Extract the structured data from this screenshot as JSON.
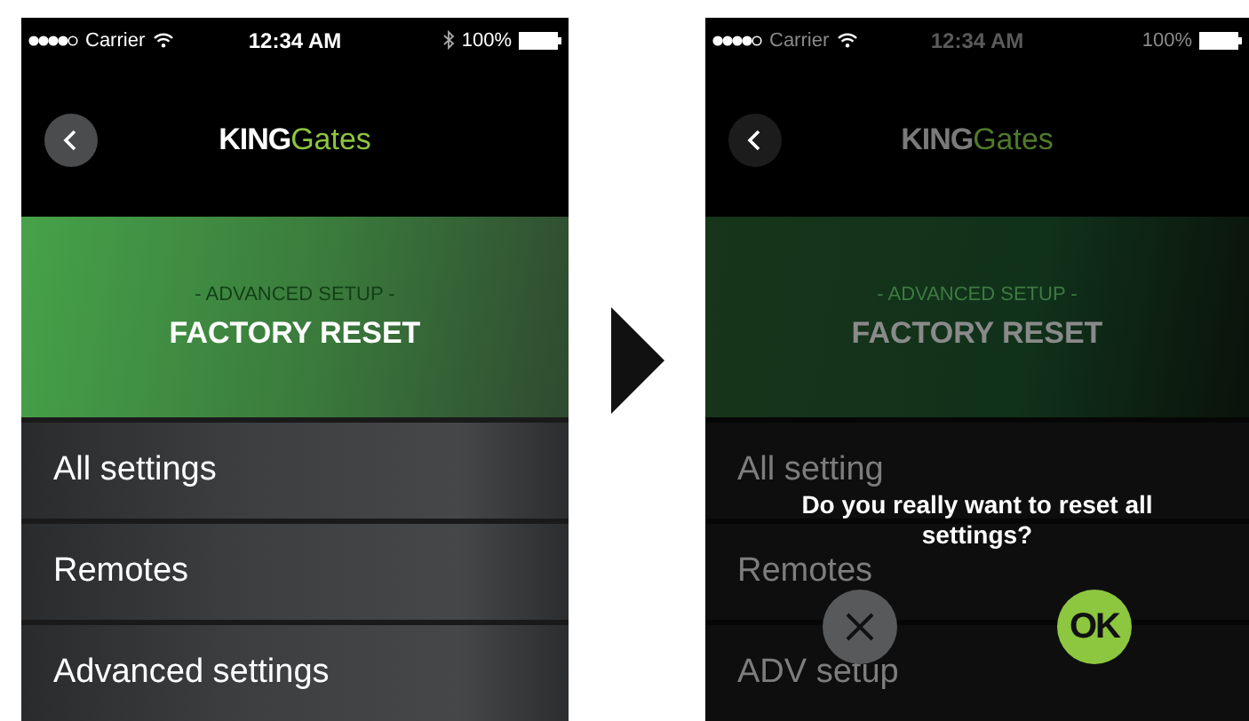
{
  "screens": [
    {
      "dimmed": false,
      "status_bar": {
        "carrier": "Carrier",
        "time": "12:34 AM",
        "battery": "100%",
        "bluetooth": true
      },
      "logo": {
        "bold": "KING",
        "light": "Gates"
      },
      "banner": {
        "subtitle": "- ADVANCED SETUP -",
        "title": "FACTORY RESET"
      },
      "menu": [
        "All settings",
        "Remotes",
        "Advanced settings"
      ]
    },
    {
      "dimmed": true,
      "status_bar": {
        "carrier": "Carrier",
        "time": "12:34 AM",
        "battery": "100%",
        "bluetooth": false
      },
      "logo": {
        "bold": "KING",
        "light": "Gates"
      },
      "banner": {
        "subtitle": "- ADVANCED SETUP -",
        "title": "FACTORY RESET"
      },
      "menu": [
        "All setting",
        "Remotes",
        "ADV setup"
      ],
      "dialog": {
        "question": "Do you really want to reset all settings?",
        "confirm": "OK"
      }
    }
  ]
}
